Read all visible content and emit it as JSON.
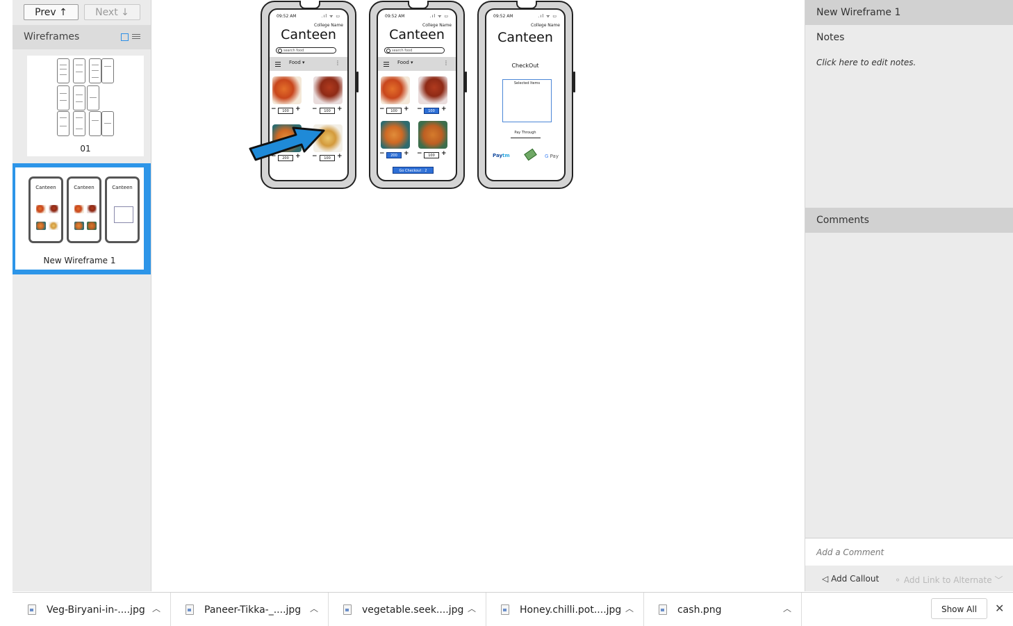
{
  "sidebar": {
    "prev_label": "Prev ↑",
    "next_label": "Next ↓",
    "header": "Wireframes",
    "thumbnails": [
      {
        "label": "01",
        "selected": false
      },
      {
        "label": "New Wireframe 1",
        "selected": true
      }
    ]
  },
  "wireframe": {
    "phones": [
      {
        "time": "09:52 AM",
        "college": "College Name",
        "title": "Canteen",
        "search_placeholder": "search food",
        "menu_label": "Food",
        "quantities": [
          "100",
          "100",
          "200",
          "100"
        ]
      },
      {
        "time": "09:52 AM",
        "college": "College Name",
        "title": "Canteen",
        "search_placeholder": "search food",
        "menu_label": "Food",
        "quantities": [
          "100",
          "100",
          "200",
          "100"
        ],
        "checkout_button": "Go Checkout : 2"
      },
      {
        "time": "09:52 AM",
        "college": "College Name",
        "title": "Canteen",
        "checkout_title": "CheckOut",
        "selected_items": "Selected Items",
        "pay_through": "Pay Through",
        "paytm": "Paytm",
        "gpay": "G Pay"
      }
    ],
    "mini_title": "Canteen",
    "arrow_color": "#1f8ad8"
  },
  "right_panel": {
    "title": "New Wireframe 1",
    "notes_label": "Notes",
    "notes_placeholder": "Click here to edit notes.",
    "comments_label": "Comments",
    "comment_placeholder": "Add a Comment",
    "add_callout": "Add Callout",
    "add_link": "Add Link to Alternate"
  },
  "downloads": {
    "items": [
      {
        "name": "Veg-Biryani-in-....jpg"
      },
      {
        "name": "Paneer-Tikka-_....jpg"
      },
      {
        "name": "vegetable.seek....jpg"
      },
      {
        "name": "Honey.chilli.pot....jpg"
      },
      {
        "name": "cash.png"
      }
    ],
    "show_all": "Show All"
  },
  "colors": {
    "accent": "#2d95e8",
    "selected_qty": "#2d6fd6"
  }
}
